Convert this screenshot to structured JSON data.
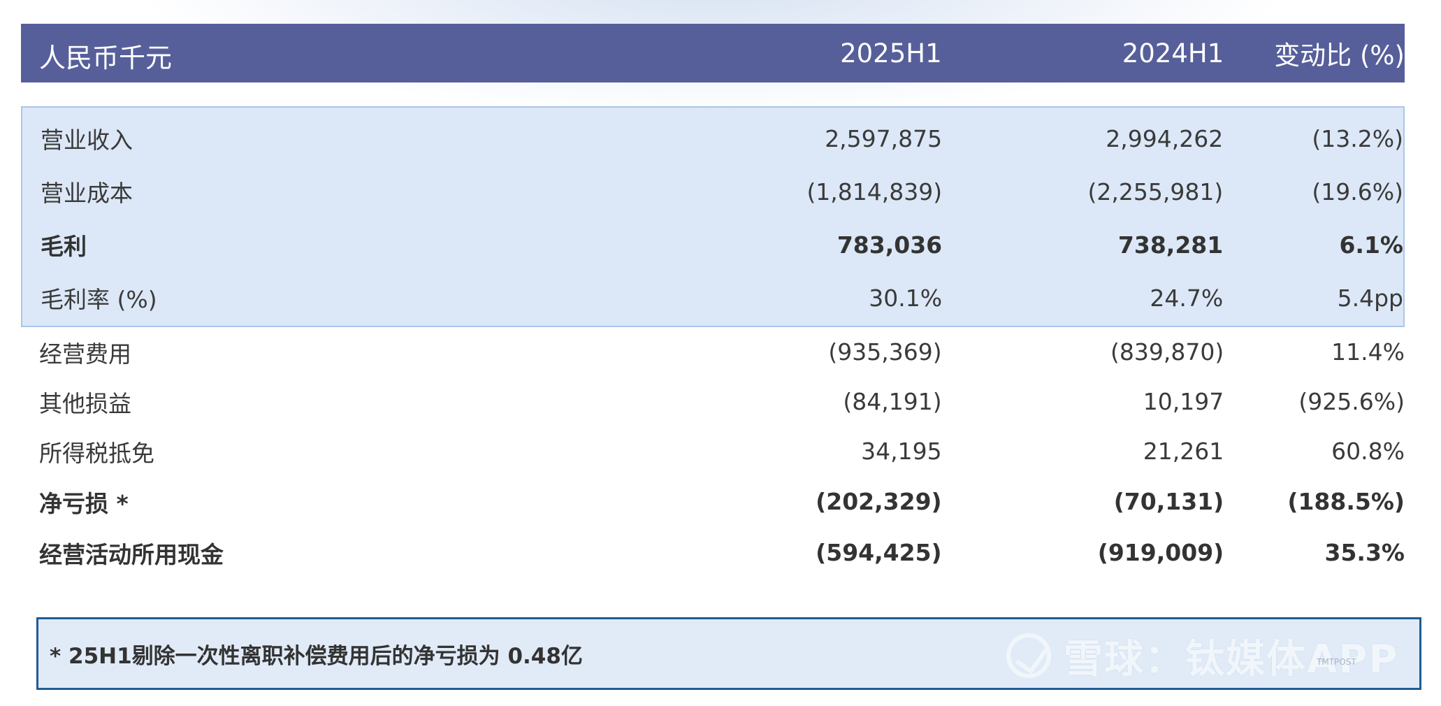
{
  "header": {
    "unit_label": "人民币千元",
    "col1": "2025H1",
    "col2": "2024H1",
    "col3": "变动比 (%)"
  },
  "highlight_rows": [
    {
      "label": "营业收入",
      "v2025": "2,597,875",
      "v2024": "2,994,262",
      "change": "(13.2%)"
    },
    {
      "label": "营业成本",
      "v2025": "(1,814,839)",
      "v2024": "(2,255,981)",
      "change": "(19.6%)"
    },
    {
      "label": "毛利",
      "v2025": "783,036",
      "v2024": "738,281",
      "change": "6.1%"
    },
    {
      "label": "毛利率 (%)",
      "v2025": "30.1%",
      "v2024": "24.7%",
      "change": "5.4pp"
    }
  ],
  "rows": [
    {
      "label": "经营费用",
      "v2025": "(935,369)",
      "v2024": "(839,870)",
      "change": "11.4%"
    },
    {
      "label": "其他损益",
      "v2025": "(84,191)",
      "v2024": "10,197",
      "change": "(925.6%)"
    },
    {
      "label": "所得税抵免",
      "v2025": "34,195",
      "v2024": "21,261",
      "change": "60.8%"
    },
    {
      "label": "净亏损 *",
      "v2025": "(202,329)",
      "v2024": "(70,131)",
      "change": "(188.5%)"
    },
    {
      "label": "经营活动所用现金",
      "v2025": "(594,425)",
      "v2024": "(919,009)",
      "change": "35.3%"
    }
  ],
  "note": {
    "text": "* 25H1剔除一次性离职补偿费用后的净亏损为 0.48亿"
  },
  "watermark": {
    "text": "雪球：钛媒体APP",
    "small_text": "TMTPOST"
  },
  "colors": {
    "header_bg": "#565f9a",
    "highlight_bg": "#dce8f7",
    "highlight_border": "#a9c6ea",
    "note_bg": "#e1ebf8",
    "note_border": "#1f5d92"
  }
}
